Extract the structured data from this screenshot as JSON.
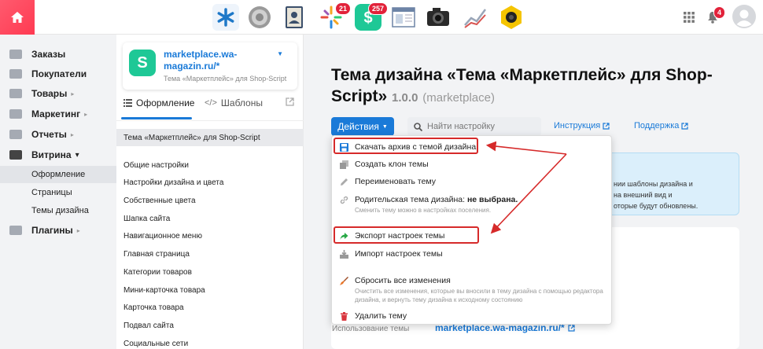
{
  "topbar": {
    "apps": [
      {
        "icon": "asterisk-app-icon"
      },
      {
        "icon": "gear-app-icon"
      },
      {
        "icon": "contacts-app-icon"
      },
      {
        "icon": "sparkle-app-icon",
        "badge": "21"
      },
      {
        "icon": "shop-app-icon",
        "badge": "257"
      },
      {
        "icon": "site-app-icon"
      },
      {
        "icon": "camera-app-icon"
      },
      {
        "icon": "chart-app-icon"
      },
      {
        "icon": "webcam-app-icon"
      }
    ],
    "notifications_badge": "4"
  },
  "leftnav": {
    "items": [
      {
        "label": "Заказы",
        "icon": "orders-icon"
      },
      {
        "label": "Покупатели",
        "icon": "customers-icon"
      },
      {
        "label": "Товары",
        "icon": "products-icon",
        "caret": "▸"
      },
      {
        "label": "Маркетинг",
        "icon": "marketing-icon",
        "caret": "▸"
      },
      {
        "label": "Отчеты",
        "icon": "reports-icon",
        "caret": "▸"
      },
      {
        "label": "Витрина",
        "icon": "storefront-icon",
        "caret": "▾"
      },
      {
        "label": "Плагины",
        "icon": "plugins-icon",
        "caret": "▸"
      }
    ],
    "subitems": [
      {
        "label": "Оформление",
        "active": true
      },
      {
        "label": "Страницы",
        "active": false
      },
      {
        "label": "Темы дизайна",
        "active": false
      }
    ]
  },
  "site": {
    "name": "marketplace.wa-magazin.ru/*",
    "subtitle": "Тема «Маркетплейс» для Shop-Script",
    "logo": "S"
  },
  "midtabs": {
    "design": "Оформление",
    "templates": "Шаблоны"
  },
  "midlist": {
    "selected": "Тема «Маркетплейс» для Shop-Script",
    "items": [
      "Общие настройки",
      "Настройки дизайна и цвета",
      "Собственные цвета",
      "Шапка сайта",
      "Навигационное меню",
      "Главная страница",
      "Категории товаров",
      "Мини-карточка товара",
      "Карточка товара",
      "Подвал сайта",
      "Социальные сети"
    ]
  },
  "main": {
    "title": "Тема дизайна «Тема «Маркетплейс» для Shop-Script»",
    "version": "1.0.0",
    "theme_id": "(marketplace)",
    "actions_label": "Действия",
    "search_placeholder": "Найти настройку",
    "instruction_link": "Инструкция",
    "support_link": "Поддержка",
    "info_lines": [
      "нии шаблоны дизайна и",
      "на внешний вид и",
      "оторые будут обновлены."
    ],
    "usage_label": "Использование темы",
    "usage_value": "marketplace.wa-magazin.ru/*"
  },
  "dropdown": {
    "download": "Скачать архив с темой дизайна",
    "clone": "Создать клон темы",
    "rename": "Переименовать тему",
    "parent_prefix": "Родительская тема дизайна: ",
    "parent_value": "не выбрана.",
    "parent_note": "Сменить тему можно в настройках поселения.",
    "export": "Экспорт настроек темы",
    "import": "Импорт настроек темы",
    "reset": "Сбросить все изменения",
    "reset_note": "Очистить все изменения, которые вы вносили в тему дизайна с помощью редактора дизайна, и вернуть тему дизайна к исходному состоянию",
    "delete": "Удалить тему"
  },
  "colors": {
    "accent": "#1a7ad8",
    "home": "#ff4a60",
    "annotation": "#d62a2a"
  }
}
